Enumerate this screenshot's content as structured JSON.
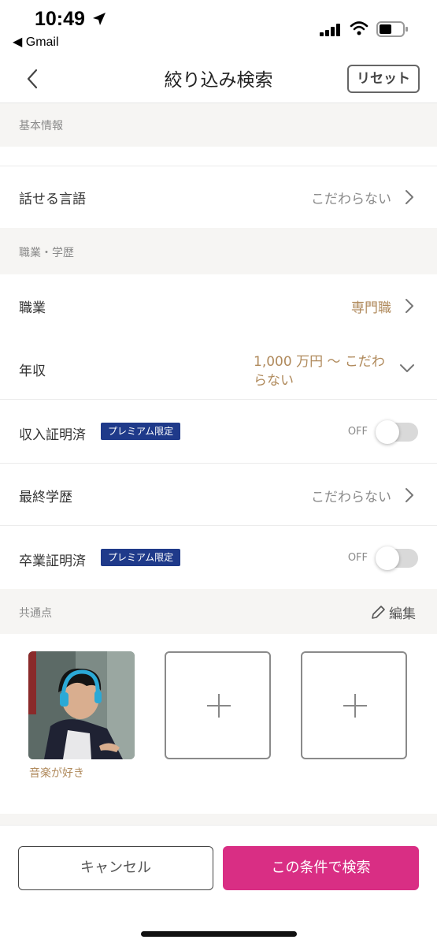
{
  "status_bar": {
    "time": "10:49",
    "back_app": "◀ Gmail"
  },
  "nav": {
    "title": "絞り込み検索",
    "reset_label": "リセット"
  },
  "sections": {
    "basic_info": "基本情報",
    "job_education": "職業・学歴",
    "common_points": "共通点"
  },
  "rows": {
    "language": {
      "label": "話せる言語",
      "value": "こだわらない"
    },
    "occupation": {
      "label": "職業",
      "value": "専門職"
    },
    "income": {
      "label": "年収",
      "value_line1": "1,000 万円 〜 こだわ",
      "value_line2": "らない"
    },
    "income_verified": {
      "label": "収入証明済",
      "badge": "プレミアム限定",
      "toggle_text": "OFF",
      "toggle_on": false
    },
    "education": {
      "label": "最終学歴",
      "value": "こだわらない"
    },
    "graduation_verified": {
      "label": "卒業証明済",
      "badge": "プレミアム限定",
      "toggle_text": "OFF",
      "toggle_on": false
    }
  },
  "common_points": {
    "edit_label": "編集",
    "items": [
      {
        "caption": "音楽が好き",
        "image": "person-with-headphones"
      }
    ]
  },
  "footer": {
    "cancel_label": "キャンセル",
    "search_label": "この条件で検索"
  },
  "colors": {
    "accent": "#d92e84",
    "gold": "#b08a5c",
    "badge": "#1f3a8a",
    "section_bg": "#f6f5f3"
  }
}
